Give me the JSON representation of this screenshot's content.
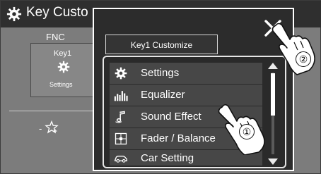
{
  "titlebar": {
    "title": "Key Custo",
    "icon": "gear-icon"
  },
  "panel": {
    "fnc_label": "FNC",
    "key_label": "Key1",
    "key_icon": "gear-icon",
    "key_setting": "Settings",
    "fav_dash": "-",
    "fav_icon": "star-add-icon"
  },
  "popup": {
    "title": "Key1 Customize",
    "close_icon": "close-icon",
    "items": [
      {
        "label": "Settings",
        "icon": "gear-icon"
      },
      {
        "label": "Equalizer",
        "icon": "equalizer-icon"
      },
      {
        "label": "Sound Effect",
        "icon": "music-note-icon"
      },
      {
        "label": "Fader / Balance",
        "icon": "fader-balance-icon"
      },
      {
        "label": "Car Setting",
        "icon": "car-icon"
      }
    ],
    "scroll_position": 0
  },
  "callouts": {
    "step1": "①",
    "step2": "②"
  },
  "colors": {
    "screen_bg": "#7c7c7c",
    "popup_bg": "#2c2c2c",
    "item_bg": "#474747",
    "text": "#ffffff"
  }
}
